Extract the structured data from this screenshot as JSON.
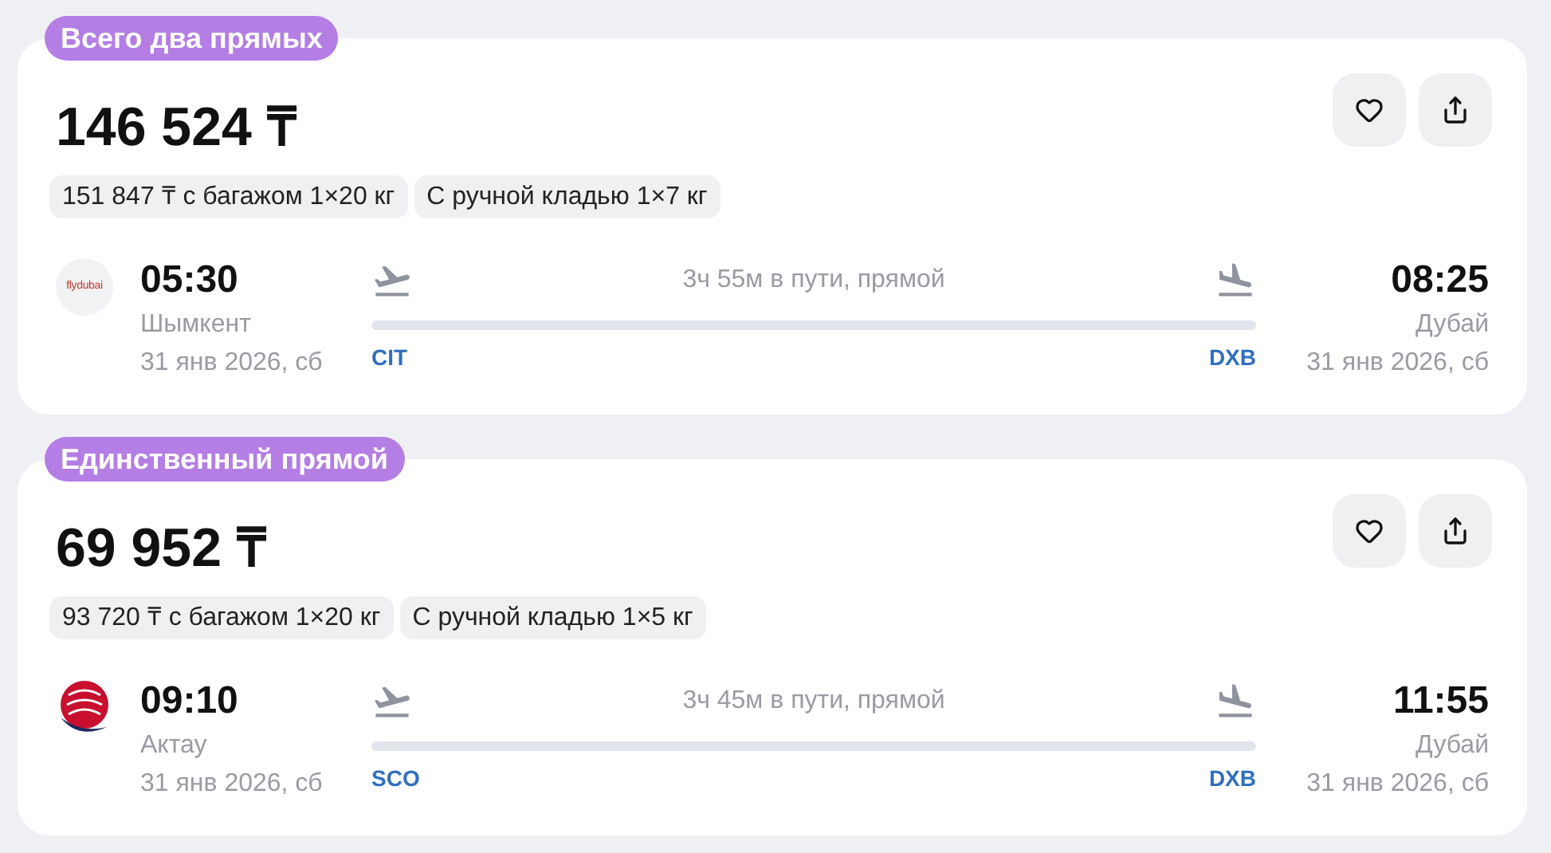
{
  "offers": [
    {
      "badge": "Всего два прямых",
      "price": "146 524 ₸",
      "chips": [
        "151 847 ₸ с багажом 1×20 кг",
        "С ручной кладью 1×7 кг"
      ],
      "airline": {
        "kind": "wordmark",
        "logo_text": "flydubai"
      },
      "departure": {
        "time": "05:30",
        "city": "Шымкент",
        "date": "31 янв 2026, сб",
        "code": "CIT"
      },
      "duration": "3ч 55м в пути, прямой",
      "arrival": {
        "time": "08:25",
        "city": "Дубай",
        "date": "31 янв 2026, сб",
        "code": "DXB"
      }
    },
    {
      "badge": "Единственный прямой",
      "price": "69 952 ₸",
      "chips": [
        "93 720 ₸ с багажом 1×20 кг",
        "С ручной кладью 1×5 кг"
      ],
      "airline": {
        "kind": "emblem"
      },
      "departure": {
        "time": "09:10",
        "city": "Актау",
        "date": "31 янв 2026, сб",
        "code": "SCO"
      },
      "duration": "3ч 45м в пути, прямой",
      "arrival": {
        "time": "11:55",
        "city": "Дубай",
        "date": "31 янв 2026, сб",
        "code": "DXB"
      }
    }
  ]
}
